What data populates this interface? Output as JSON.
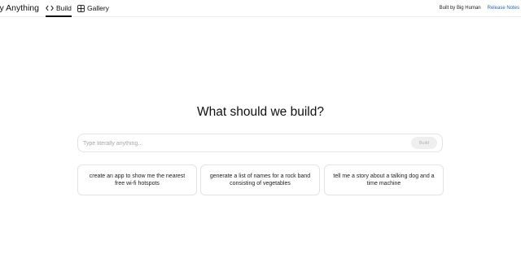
{
  "header": {
    "brand": "Literally Anything",
    "tabs": [
      {
        "label": "Build",
        "icon": "code-icon",
        "active": true
      },
      {
        "label": "Gallery",
        "icon": "grid-icon",
        "active": false
      }
    ],
    "built_by": "Built by Big Human",
    "release_notes": "Release Notes"
  },
  "main": {
    "headline": "What should we build?",
    "prompt": {
      "placeholder": "Type literally anything...",
      "value": "",
      "button_label": "Build"
    },
    "suggestions": [
      "create an app to show me the nearest free wi-fi hotspots",
      "generate a list of names for a rock band consisting of vegetables",
      "tell me a story about a talking dog and a time machine"
    ]
  },
  "colors": {
    "link": "#2a64c7",
    "border": "#e3e3e3",
    "button_bg": "#efefef"
  }
}
